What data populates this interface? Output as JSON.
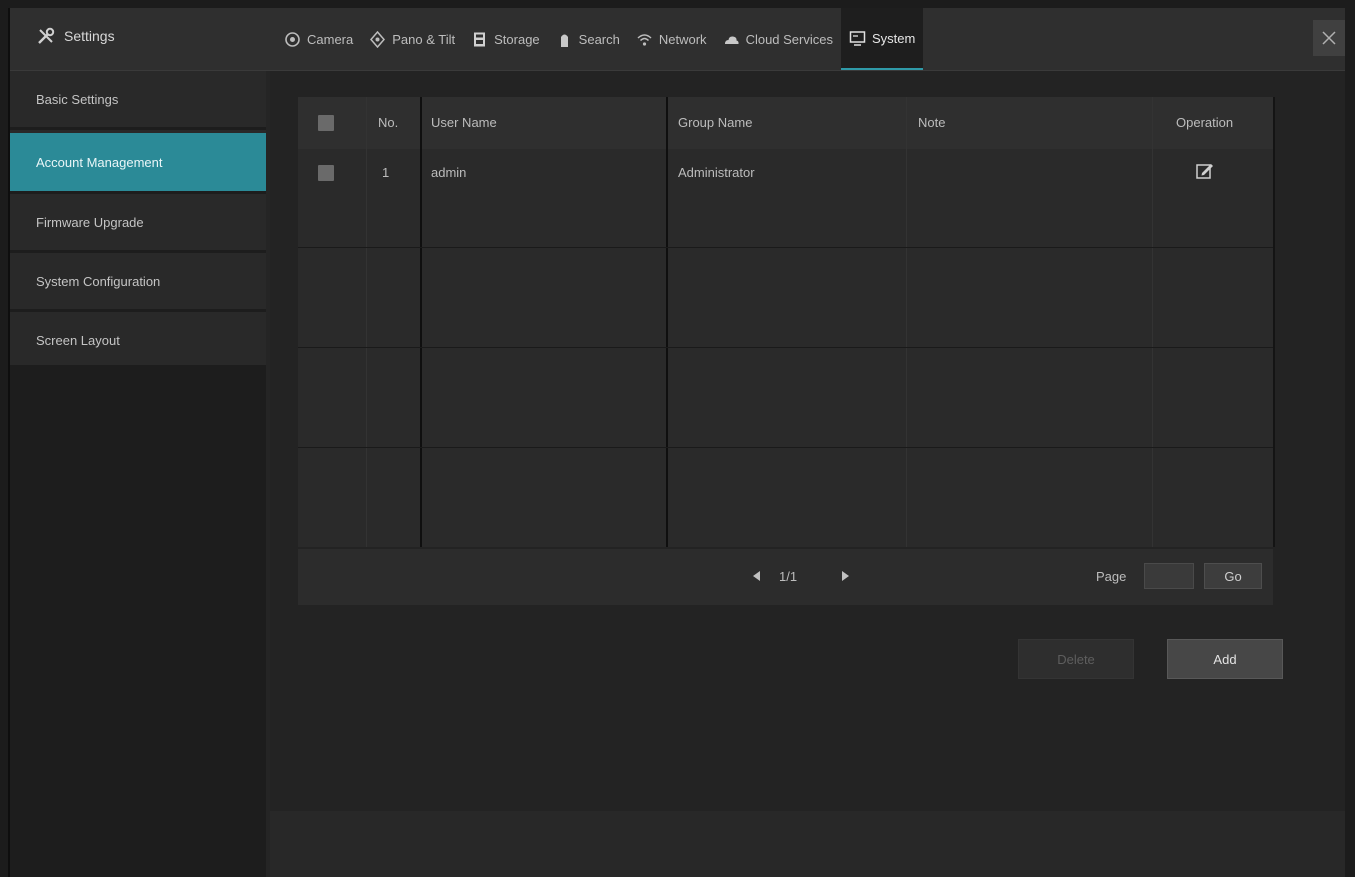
{
  "app": {
    "title": "Settings"
  },
  "tabs": [
    {
      "label": "Camera",
      "icon": "camera-icon"
    },
    {
      "label": "Pano & Tilt",
      "icon": "ptz-icon"
    },
    {
      "label": "Storage",
      "icon": "storage-icon"
    },
    {
      "label": "Search",
      "icon": "search-icon"
    },
    {
      "label": "Network",
      "icon": "network-icon"
    },
    {
      "label": "Cloud Services",
      "icon": "cloud-icon"
    },
    {
      "label": "System",
      "icon": "system-icon",
      "active": true
    }
  ],
  "sidebar": {
    "items": [
      {
        "label": "Basic Settings"
      },
      {
        "label": "Account Management",
        "active": true
      },
      {
        "label": "Firmware Upgrade"
      },
      {
        "label": "System Configuration"
      },
      {
        "label": "Screen Layout"
      }
    ]
  },
  "table": {
    "columns": {
      "no": "No.",
      "username": "User Name",
      "group": "Group Name",
      "note": "Note",
      "operation": "Operation"
    },
    "rows": [
      {
        "no": "1",
        "username": "admin",
        "group": "Administrator",
        "note": ""
      }
    ]
  },
  "pager": {
    "info": "1/1",
    "page_label": "Page",
    "page_value": "",
    "go_label": "Go"
  },
  "actions": {
    "delete_label": "Delete",
    "add_label": "Add"
  },
  "colors": {
    "accent": "#2b8a97",
    "background": "#232323",
    "panel": "#2a2a2a"
  }
}
